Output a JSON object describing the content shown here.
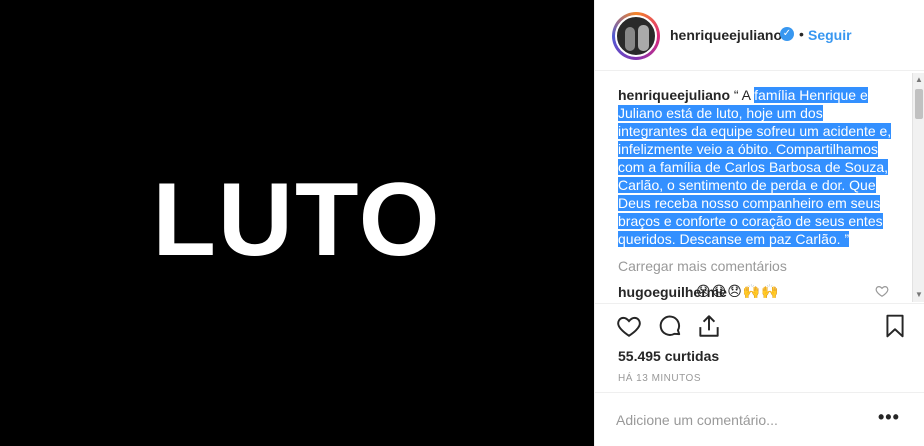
{
  "media": {
    "text": "LUTO"
  },
  "header": {
    "username": "henriqueejuliano",
    "separator": "•",
    "follow_label": "Seguir"
  },
  "caption": {
    "username": "henriqueejuliano",
    "prefix": "“ A ",
    "highlighted": "família Henrique e Juliano está de luto, hoje um dos integrantes da equipe sofreu um acidente e, infelizmente veio a óbito. Compartilhamos com a família de Carlos Barbosa de Souza, Carlão, o sentimento de perda e dor. Que Deus receba nosso companheiro em seus braços e conforte o coração de seus entes queridos. Descanse em paz Carlão. ”"
  },
  "comments": {
    "load_more": "Carregar mais comentários",
    "items": [
      {
        "username": "hugoeguilherme",
        "text": "😞😞😞🙌🙌"
      }
    ]
  },
  "stats": {
    "likes": "55.495 curtidas",
    "time": "HÁ 13 MINUTOS"
  },
  "add_comment": {
    "placeholder": "Adicione um comentário..."
  },
  "more_label": "•••",
  "icons": [
    "verified-icon",
    "heart-icon",
    "comment-icon",
    "share-icon",
    "bookmark-icon",
    "heart-small-icon",
    "scroll-up-icon",
    "scroll-down-icon"
  ],
  "colors": {
    "accent": "#3897f0",
    "highlight": "#3390ff",
    "media_bg": "#000000"
  }
}
